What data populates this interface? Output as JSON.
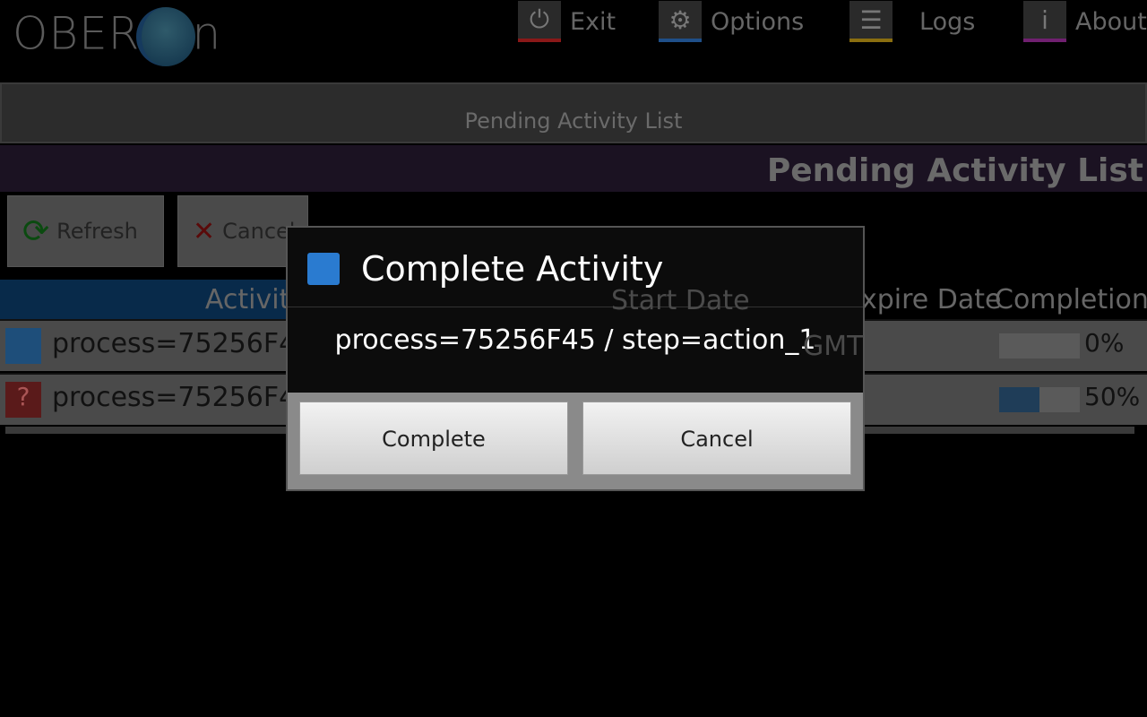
{
  "logo": {
    "text_left": "OBER",
    "text_right": "n"
  },
  "nav": [
    {
      "label": "Exit",
      "icon": "power-icon",
      "color": "#b52020"
    },
    {
      "label": "Options",
      "icon": "gear-icon",
      "color": "#2a6bb5"
    },
    {
      "label": "Logs",
      "icon": "list-icon",
      "color": "#c9a020"
    },
    {
      "label": "About",
      "icon": "info-icon",
      "color": "#a030a0"
    }
  ],
  "tab_bar": "Pending Activity List",
  "page_title": "Pending Activity List",
  "toolbar": {
    "refresh": "Refresh",
    "cancel": "Cancel"
  },
  "table": {
    "headers": [
      "Activity",
      "Start Date",
      "Expire Date",
      "Completion"
    ],
    "rows": [
      {
        "activity": "process=75256F45 / step=action_1",
        "start": "GMT",
        "completion": 0,
        "completion_label": "0%",
        "icon": "user-icon"
      },
      {
        "activity": "process=75256F45",
        "start": "",
        "completion": 50,
        "completion_label": "50%",
        "icon": "question-icon"
      }
    ]
  },
  "dialog": {
    "title": "Complete Activity",
    "message": "process=75256F45 / step=action_1",
    "complete": "Complete",
    "cancel": "Cancel"
  }
}
